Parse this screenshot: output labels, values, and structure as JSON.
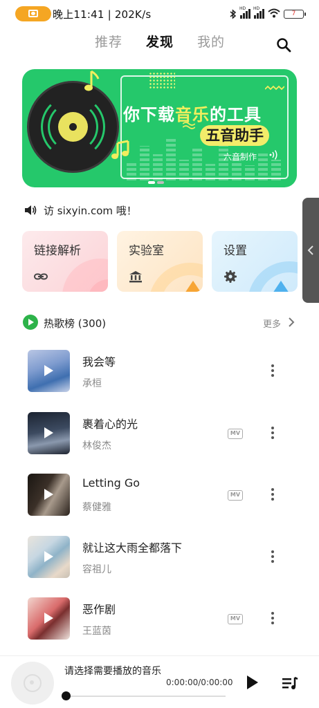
{
  "status_bar": {
    "time": "晚上11:41 | 202K/s",
    "battery": "7",
    "icons": [
      "camera-icon",
      "bluetooth-icon",
      "signal-icon",
      "signal-icon",
      "wifi-icon",
      "battery-icon"
    ],
    "signal_label": "HD"
  },
  "tabs": [
    {
      "label": "推荐",
      "active": false
    },
    {
      "label": "发现",
      "active": true
    },
    {
      "label": "我的",
      "active": false
    }
  ],
  "banner": {
    "title_part1": "你下载",
    "title_highlight": "音乐",
    "title_part2": "的工具",
    "subtitle": "五音助手",
    "maker": "六音制作",
    "colors": {
      "background": "#25c86b",
      "accent": "#f1ee5e"
    }
  },
  "notice": {
    "text": "访 sixyin.com 哦！"
  },
  "shortcuts": [
    {
      "label": "链接解析",
      "icon": "link-icon",
      "color": "#fde3e5"
    },
    {
      "label": "实验室",
      "icon": "bank-icon",
      "color": "#fdeed8"
    },
    {
      "label": "设置",
      "icon": "gear-icon",
      "color": "#dcf0fb"
    }
  ],
  "hot_list": {
    "title": "热歌榜 (300)",
    "more": "更多",
    "songs": [
      {
        "title": "我会等",
        "artist": "承桓",
        "mv": false
      },
      {
        "title": "裹着心的光",
        "artist": "林俊杰",
        "mv": true
      },
      {
        "title": "Letting Go",
        "artist": "蔡健雅",
        "mv": true
      },
      {
        "title": "就让这大雨全都落下",
        "artist": "容祖儿",
        "mv": false
      },
      {
        "title": "恶作剧",
        "artist": "王蓝茵",
        "mv": true
      }
    ],
    "mv_label": "MV"
  },
  "player": {
    "prompt": "请选择需要播放的音乐",
    "time": "0:00:00/0:00:00",
    "progress": 0
  }
}
